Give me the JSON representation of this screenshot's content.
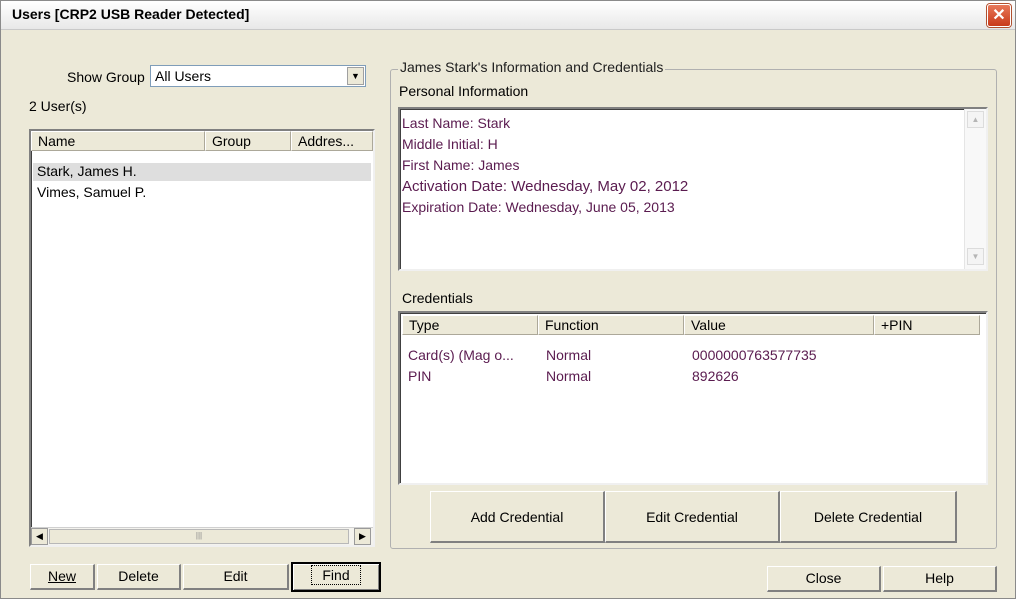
{
  "window": {
    "title": "Users [CRP2 USB Reader Detected]",
    "close_glyph": "✕"
  },
  "left": {
    "show_group_label": "Show Group",
    "group_select_value": "All Users",
    "user_count": "2 User(s)",
    "columns": [
      "Name",
      "Group",
      "Addres..."
    ],
    "users": [
      {
        "name": "Stark, James H.",
        "selected": true
      },
      {
        "name": "Vimes, Samuel P.",
        "selected": false
      }
    ],
    "buttons": {
      "new": "New",
      "delete": "Delete",
      "edit": "Edit",
      "find": "Find"
    }
  },
  "right": {
    "group_title": "James Stark's Information and Credentials",
    "personal_label": "Personal Information",
    "personal_lines": [
      "Last Name: Stark",
      "Middle Initial: H",
      "First Name: James",
      "Activation Date: Wednesday, May 02, 2012",
      "Expiration Date: Wednesday, June 05, 2013"
    ],
    "credentials_label": "Credentials",
    "cred_columns": [
      "Type",
      "Function",
      "Value",
      "+PIN"
    ],
    "credentials": [
      {
        "type": "Card(s) (Mag o...",
        "function": "Normal",
        "value": "0000000763577735",
        "pin": ""
      },
      {
        "type": "PIN",
        "function": "Normal",
        "value": "892626",
        "pin": ""
      }
    ],
    "buttons": {
      "add": "Add Credential",
      "edit": "Edit Credential",
      "delete": "Delete Credential"
    }
  },
  "footer": {
    "close": "Close",
    "help": "Help"
  },
  "colors": {
    "text_purple": "#5a1b4f",
    "dialog_bg": "#ece9d8",
    "close_red": "#d9532f"
  },
  "icons": {
    "dropdown": "chevron-down-icon",
    "scroll_left": "arrow-left-icon",
    "scroll_right": "arrow-right-icon",
    "scroll_up": "arrow-up-icon",
    "scroll_down": "arrow-down-icon",
    "close": "close-icon"
  }
}
